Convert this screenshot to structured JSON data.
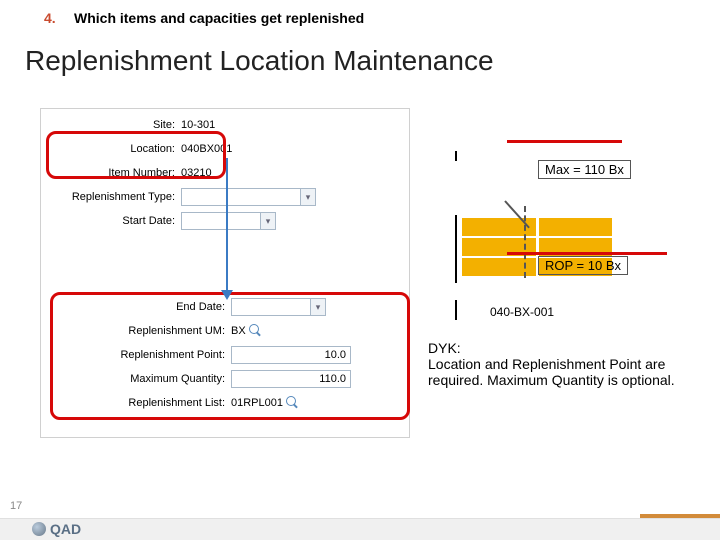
{
  "header": {
    "list_number": "4.",
    "topic": "Which items and capacities get replenished",
    "title": "Replenishment Location Maintenance"
  },
  "form": {
    "site_label": "Site:",
    "site_value": "10-301",
    "location_label": "Location:",
    "location_value": "040BX001",
    "item_label": "Item Number:",
    "item_value": "03210",
    "repl_type_label": "Replenishment Type:",
    "repl_type_value": "",
    "start_date_label": "Start Date:",
    "start_date_value": "",
    "end_date_label": "End Date:",
    "end_date_value": "",
    "repl_um_label": "Replenishment UM:",
    "repl_um_value": "BX",
    "repl_point_label": "Replenishment Point:",
    "repl_point_value": "10.0",
    "max_qty_label": "Maximum Quantity:",
    "max_qty_value": "110.0",
    "repl_list_label": "Replenishment List:",
    "repl_list_value": "01RPL001"
  },
  "diagram": {
    "max_label": "Max = 110 Bx",
    "rop_label": "ROP = 10 Bx",
    "location_tag": "040-BX-001"
  },
  "dyk": {
    "title": "DYK:",
    "body": "Location and Replenishment Point are required.  Maximum Quantity is optional."
  },
  "footer": {
    "page_number": "17",
    "logo_text": "QAD"
  }
}
